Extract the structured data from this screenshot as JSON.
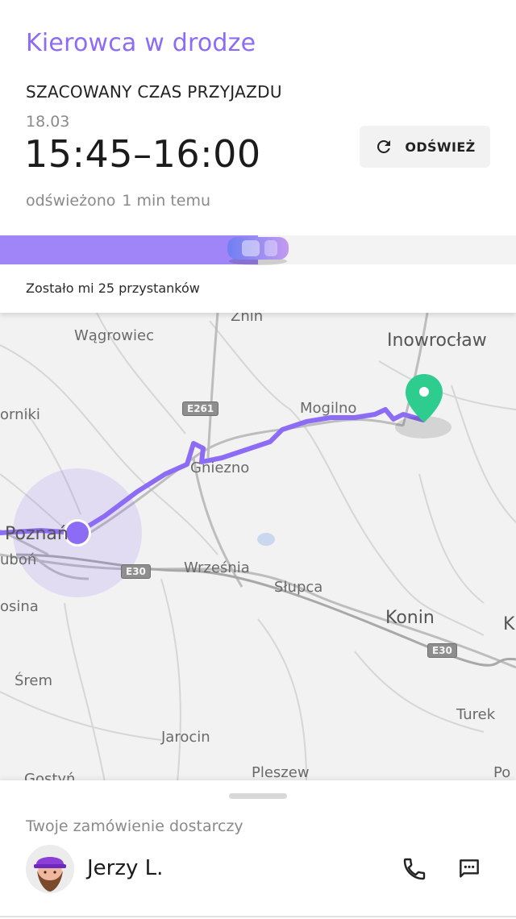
{
  "header": {
    "title": "Kierowca w drodze",
    "eta_label": "SZACOWANY CZAS PRZYJAZDU",
    "date": "18.03",
    "eta_window": "15:45–16:00",
    "refreshed_prefix": "odświeżono",
    "refreshed_ago": "1 min temu",
    "refresh_button_label": "ODŚWIEŻ",
    "progress_fraction": 0.5,
    "stops_remaining_text": "Zostało mi 25 przystanków",
    "accent_color": "#8d6cf5"
  },
  "map": {
    "towns": {
      "znin": "Żnin",
      "wagrowiec": "Wągrowiec",
      "inowroclaw": "Inowrocław",
      "orniki": "orniki",
      "mogilno": "Mogilno",
      "gniezno": "Gniezno",
      "poznan": "Poznań",
      "lubon": "uboń",
      "wrzesnia": "Września",
      "slupca": "Słupca",
      "mosina": "osina",
      "konin": "Konin",
      "srem": "Śrem",
      "turek": "Turek",
      "jarocin": "Jarocin",
      "pleszew": "Pleszew",
      "gostyn": "Gostyń",
      "edge_k": "K",
      "edge_po": "Po"
    },
    "roads": {
      "e261": "E261",
      "e30_a": "E30",
      "e30_b": "E30"
    },
    "route_color": "#8d6cf5",
    "destination_color": "#2ecc8f"
  },
  "sheet": {
    "order_label": "Twoje zamówienie dostarczy",
    "driver_name": "Jerzy L."
  }
}
